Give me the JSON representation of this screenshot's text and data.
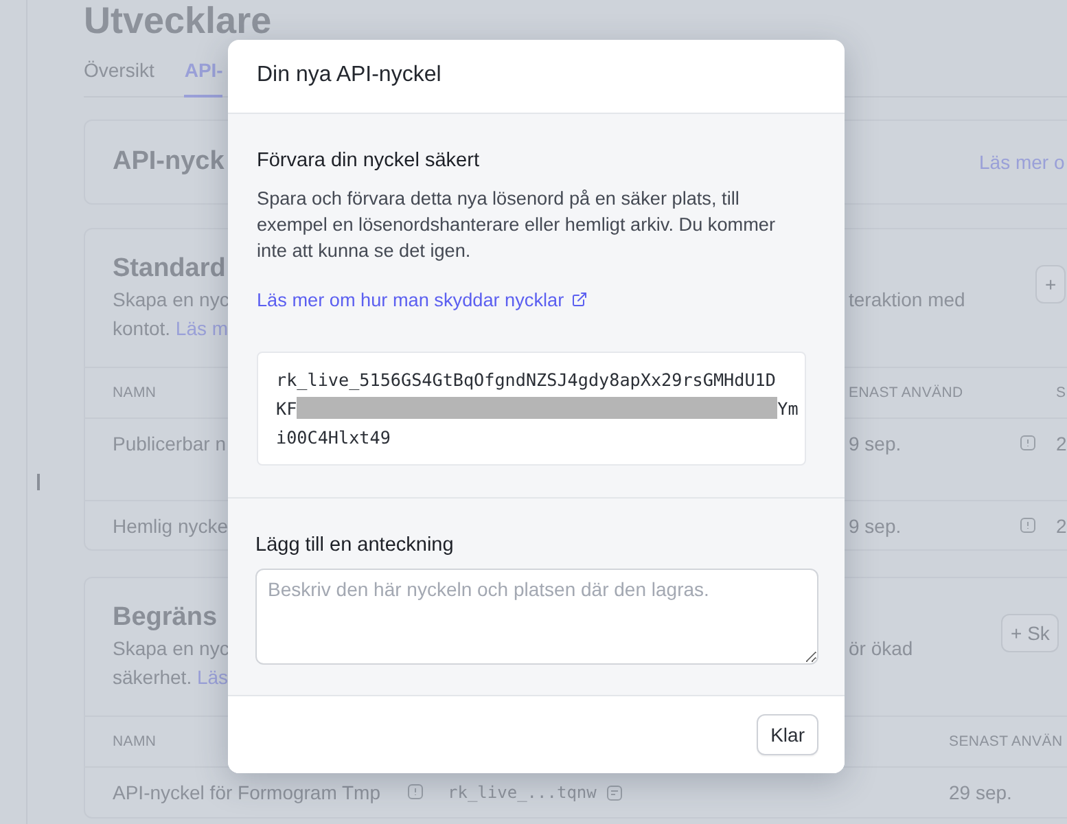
{
  "page": {
    "title": "Utvecklare",
    "tabs": [
      {
        "label": "Översikt",
        "selected": false
      },
      {
        "label": "API-",
        "selected": true
      }
    ]
  },
  "api_card": {
    "title": "API-nyck",
    "link": "Läs mer o"
  },
  "standard_card": {
    "title": "Standard",
    "desc_left": "Skapa en nyc",
    "desc_right": "teraktion med",
    "desc2_prefix": "kontot.",
    "desc2_link": "Läs m",
    "add_button": "+",
    "columns": [
      "NAMN",
      "ENAST ANVÄND",
      "S"
    ],
    "rows": [
      {
        "name": "Publicerbar n",
        "last_used": "9 sep.",
        "column_3": "2"
      },
      {
        "name": "Hemlig nycke",
        "last_used": "9 sep.",
        "column_3": "2"
      }
    ]
  },
  "restricted_card": {
    "title": "Begräns",
    "desc_left": "Skapa en nyc",
    "desc_right": "ör ökad",
    "desc2_prefix": "säkerhet.",
    "desc2_link": "Läs",
    "add_button": "+ Sk",
    "columns": [
      "NAMN",
      "SENAST ANVÄN"
    ],
    "rows": [
      {
        "name": "API-nyckel för Formogram Tmp",
        "key": "rk_live_...tqnw",
        "last_used": "29 sep."
      }
    ]
  },
  "modal": {
    "title": "Din nya API-nyckel",
    "heading": "Förvara din nyckel säkert",
    "text": "Spara och förvara detta nya lösenord på en säker plats, till exempel en lösenordshanterare eller hemligt arkiv. Du kommer inte att kunna se det igen.",
    "link": "Läs mer om hur man skyddar nycklar",
    "key_lines": [
      {
        "kind": "plain",
        "text": "rk_live_5156GS4GtBqOfgndNZSJ4gdy8apXx29rsGMHdU1D"
      },
      {
        "kind": "redacted",
        "before": "KF",
        "after": "Ym"
      },
      {
        "kind": "plain",
        "text": "i00C4Hlxt49"
      }
    ],
    "note_label": "Lägg till en anteckning",
    "note_placeholder": "Beskriv den här nyckeln och platsen där den lagras.",
    "done_button": "Klar"
  }
}
